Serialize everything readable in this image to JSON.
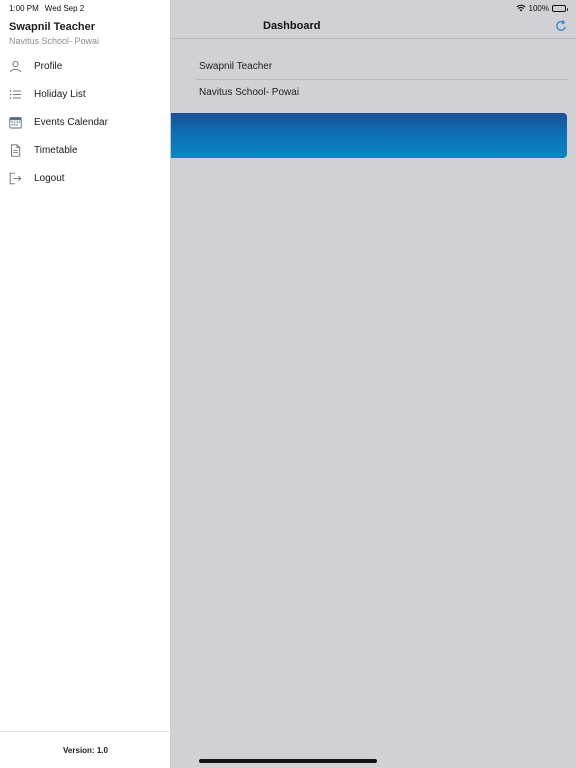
{
  "status_bar": {
    "time": "1:00 PM",
    "date": "Wed Sep 2",
    "battery": "100%"
  },
  "header": {
    "title": "Dashboard"
  },
  "main": {
    "teacher_name": "Swapnil Teacher",
    "school": "Navitus School- Powai",
    "banner_color_top": "#1b4f96",
    "banner_color_bottom": "#0b86c4"
  },
  "drawer": {
    "user_name": "Swapnil Teacher",
    "school_name": "Navitus School- Powai",
    "menu": [
      {
        "label": "Profile",
        "icon": "person-icon"
      },
      {
        "label": "Holiday List",
        "icon": "list-icon"
      },
      {
        "label": "Events Calendar",
        "icon": "calendar-icon"
      },
      {
        "label": "Timetable",
        "icon": "document-icon"
      },
      {
        "label": "Logout",
        "icon": "logout-icon"
      }
    ],
    "version": "Version: 1.0"
  },
  "colors": {
    "accent": "#2f7bd6",
    "dim_background": "#d1d0d5"
  }
}
